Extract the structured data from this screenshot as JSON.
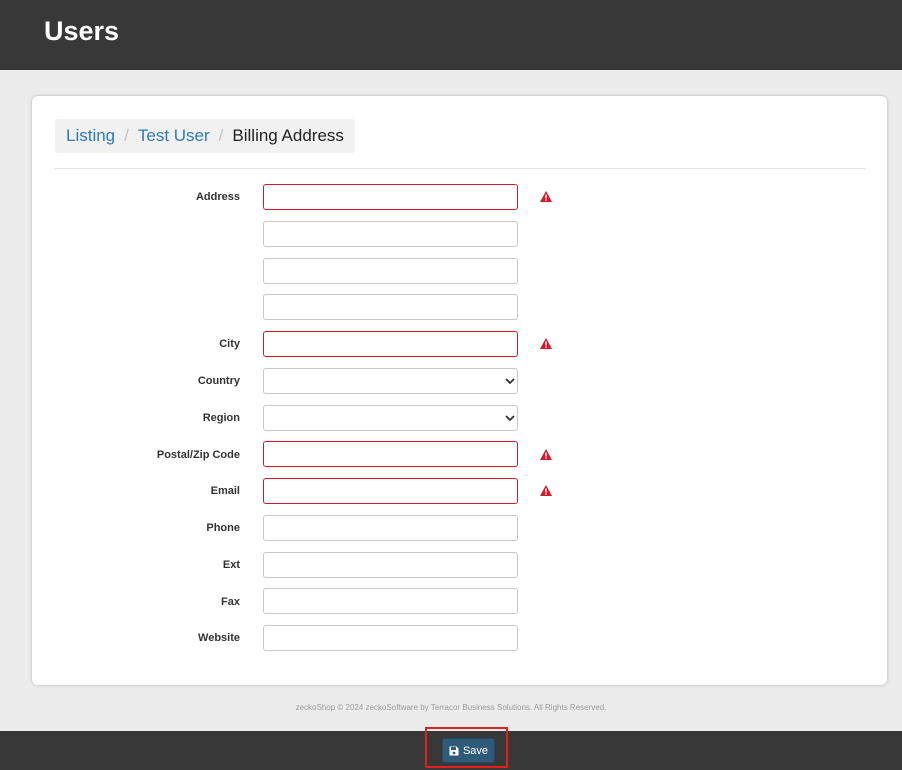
{
  "header": {
    "title": "Users"
  },
  "breadcrumb": {
    "items": [
      {
        "label": "Listing"
      },
      {
        "label": "Test User"
      },
      {
        "label": "Billing Address"
      }
    ],
    "separator": "/"
  },
  "form": {
    "address_label": "Address",
    "city_label": "City",
    "country_label": "Country",
    "region_label": "Region",
    "postal_label": "Postal/Zip Code",
    "email_label": "Email",
    "phone_label": "Phone",
    "ext_label": "Ext",
    "fax_label": "Fax",
    "website_label": "Website",
    "required_fields_with_error": [
      "Address",
      "City",
      "Postal/Zip Code",
      "Email"
    ]
  },
  "footer": {
    "copyright": "zeckoShop © 2024 zeckoSoftware by Terracor Business Solutions. All Rights Reserved."
  },
  "actions": {
    "save_label": "Save"
  },
  "colors": {
    "header_bg": "#383838",
    "error": "#d31a2c",
    "link": "#2e7ab5",
    "save_button": "#305a7a",
    "highlight": "#e0201c"
  },
  "icons": {
    "field_error": "warning-triangle-icon",
    "save": "floppy-disk-icon",
    "select": "chevron-down-icon"
  }
}
